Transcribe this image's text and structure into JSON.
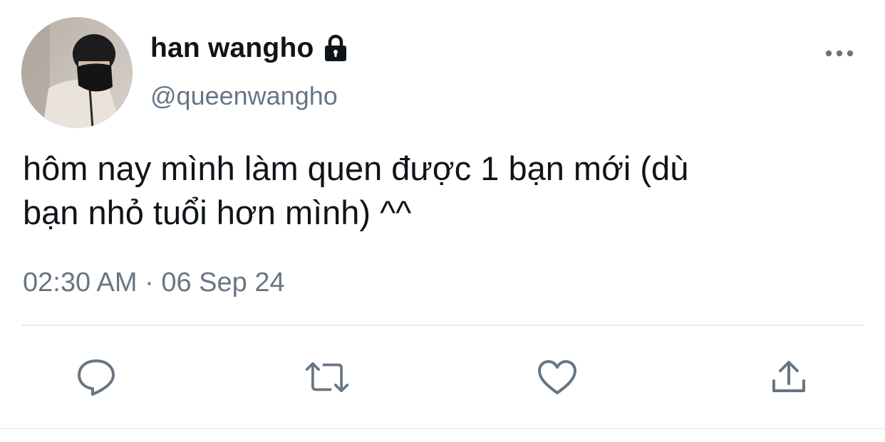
{
  "author": {
    "display_name": "han wangho",
    "handle": "@queenwangho",
    "protected_icon": "lock-icon",
    "avatar": "avatar-photo"
  },
  "tweet": {
    "line1": "hôm nay mình làm quen được 1 bạn mới (dù",
    "line2": "bạn nhỏ tuổi hơn mình) ^^",
    "time": "02:30 AM",
    "separator": "·",
    "date": "06 Sep 24"
  },
  "actions": {
    "reply_icon": "reply-icon",
    "retweet_icon": "retweet-icon",
    "like_icon": "heart-icon",
    "share_icon": "share-icon",
    "more_icon": "more-icon"
  },
  "colors": {
    "text": "#0f1419",
    "secondary": "#687684",
    "icon": "#687684",
    "divider": "#e7eaed"
  }
}
